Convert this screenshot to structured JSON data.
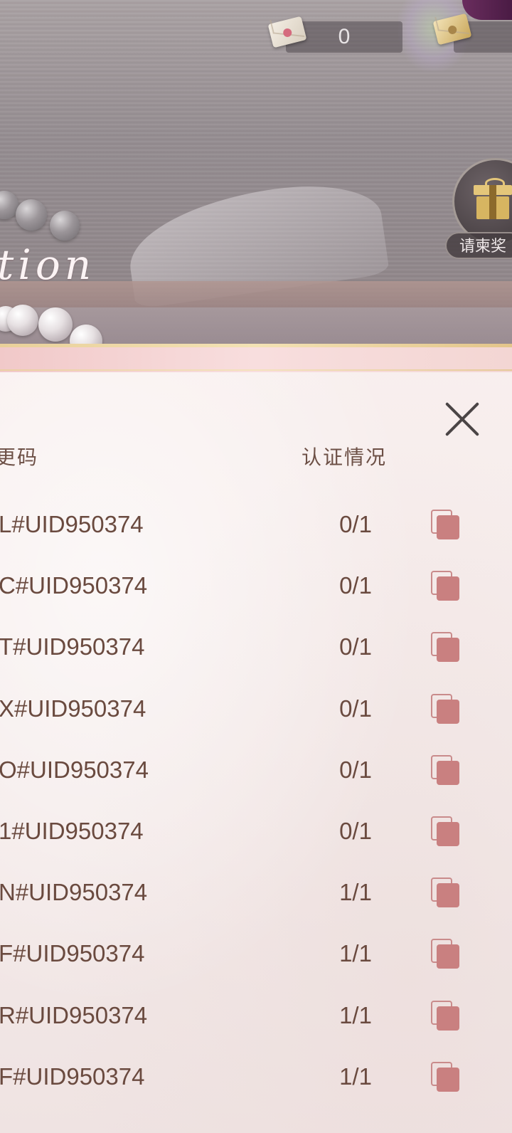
{
  "top_bar": {
    "currency_1_value": "0",
    "currency_1_icon": "pink-seal-letter-icon",
    "currency_2_icon": "gold-seal-letter-icon"
  },
  "scene": {
    "script_title": "tion"
  },
  "gift_button": {
    "label": "请柬奖",
    "icon": "gift-box-icon"
  },
  "dialog": {
    "close_icon": "close-icon",
    "header": {
      "code": "更码",
      "status": "认证情况"
    },
    "rows": [
      {
        "code": "L#UID950374",
        "status": "0/1"
      },
      {
        "code": "C#UID950374",
        "status": "0/1"
      },
      {
        "code": "T#UID950374",
        "status": "0/1"
      },
      {
        "code": "X#UID950374",
        "status": "0/1"
      },
      {
        "code": "O#UID950374",
        "status": "0/1"
      },
      {
        "code": "1#UID950374",
        "status": "0/1"
      },
      {
        "code": "N#UID950374",
        "status": "1/1"
      },
      {
        "code": "F#UID950374",
        "status": "1/1"
      },
      {
        "code": "R#UID950374",
        "status": "1/1"
      },
      {
        "code": "F#UID950374",
        "status": "1/1"
      }
    ],
    "copy_icon": "copy-icon"
  },
  "colors": {
    "text_brown": "#6a4a3f",
    "copy_icon_pink": "#c98080",
    "gold_trim": "#e9d09a"
  }
}
